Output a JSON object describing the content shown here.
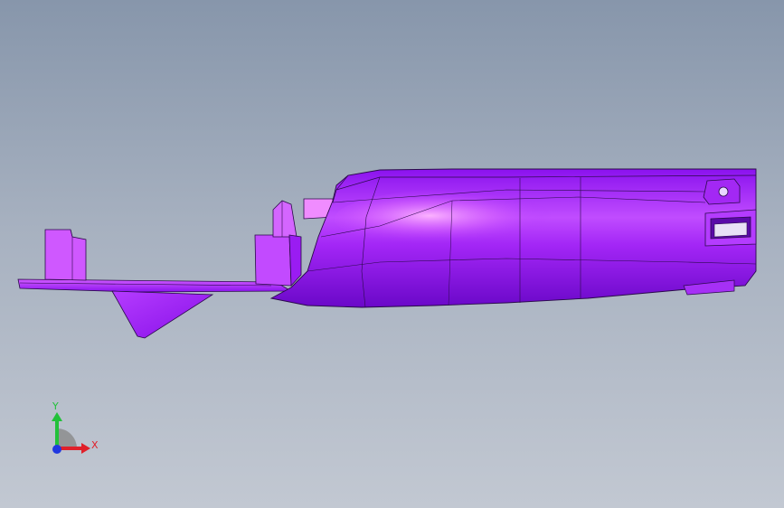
{
  "viewport": {
    "background_top": "#8796ab",
    "background_bottom": "#c2c8d2"
  },
  "model": {
    "name": "3d-part-purple",
    "color_main": "#9b19f5",
    "color_dark": "#6a06c8",
    "color_light": "#d97cff",
    "edge_color": "#2a0a4a"
  },
  "triad": {
    "x_label": "X",
    "y_label": "Y",
    "x_color": "#e0202a",
    "y_color": "#22c13a",
    "z_color": "#2038e0"
  }
}
